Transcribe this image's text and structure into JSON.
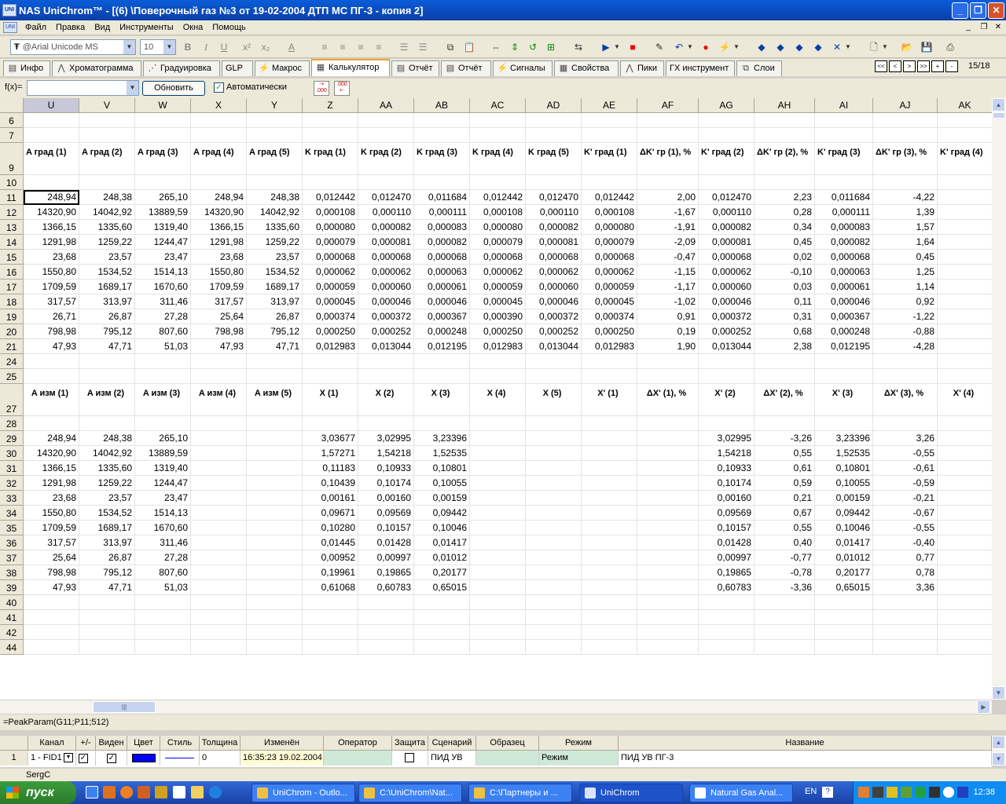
{
  "window": {
    "title": "NAS UniChrom™ - [(6) \\Поверочный газ  №3  от 19-02-2004 ДТП МС ПГ-3 - копия 2]",
    "icon": "UNI"
  },
  "menu": [
    "Файл",
    "Правка",
    "Вид",
    "Инструменты",
    "Окна",
    "Помощь"
  ],
  "toolbar": {
    "font": "@Arial Unicode MS",
    "size": "10",
    "page_counter": "15/18",
    "bold": "B",
    "italic": "I",
    "underline": "U",
    "superscript": "x²",
    "subscript": "x₂",
    "font_color": "A"
  },
  "tabs": [
    {
      "label": "Инфо",
      "icon": "info-icon"
    },
    {
      "label": "Хроматограмма",
      "icon": "chromatogram-icon"
    },
    {
      "label": "Градуировка",
      "icon": "calibration-icon"
    },
    {
      "label": "GLP",
      "icon": ""
    },
    {
      "label": "Макрос",
      "icon": "macro-icon"
    },
    {
      "label": "Калькулятор",
      "icon": "calculator-icon"
    },
    {
      "label": "Отчёт",
      "icon": "report-icon"
    },
    {
      "label": "Отчёт",
      "icon": "report-icon"
    },
    {
      "label": "Сигналы",
      "icon": "signals-icon"
    },
    {
      "label": "Свойства",
      "icon": "properties-icon"
    },
    {
      "label": "Пики",
      "icon": "peaks-icon"
    },
    {
      "label": "ГХ инструмент",
      "icon": ""
    },
    {
      "label": "Слои",
      "icon": "layers-icon"
    }
  ],
  "nav_buttons": [
    "<<",
    "<",
    ">",
    ">>",
    "+",
    "-"
  ],
  "formula_bar": {
    "label": "f(x)=",
    "value": "",
    "refresh_button": "Обновить",
    "auto_label": "Автоматически",
    "auto_checked": true
  },
  "columns": [
    "U",
    "V",
    "W",
    "X",
    "Y",
    "Z",
    "AA",
    "AB",
    "AC",
    "AD",
    "AE",
    "AF",
    "AG",
    "AH",
    "AI",
    "AJ",
    "AK"
  ],
  "rows": [
    {
      "n": "6",
      "cells": []
    },
    {
      "n": "7",
      "cells": []
    },
    {
      "n": "9",
      "type": "label",
      "cells": [
        "A град (1)",
        "A град (2)",
        "A град (3)",
        "A град (4)",
        "A град (5)",
        "K град (1)",
        "K град (2)",
        "K град (3)",
        "K град (4)",
        "K град (5)",
        "K' град (1)",
        "ΔK' гр (1), %",
        "K' град (2)",
        "ΔK' гр (2), %",
        "K' град (3)",
        "ΔK' гр (3), %",
        "K' град (4)"
      ]
    },
    {
      "n": "10",
      "cells": []
    },
    {
      "n": "11",
      "cells": [
        "248,94",
        "248,38",
        "265,10",
        "248,94",
        "248,38",
        "0,012442",
        "0,012470",
        "0,011684",
        "0,012442",
        "0,012470",
        "0,012442",
        "2,00",
        "0,012470",
        "2,23",
        "0,011684",
        "-4,22",
        ""
      ]
    },
    {
      "n": "12",
      "cells": [
        "14320,90",
        "14042,92",
        "13889,59",
        "14320,90",
        "14042,92",
        "0,000108",
        "0,000110",
        "0,000111",
        "0,000108",
        "0,000110",
        "0,000108",
        "-1,67",
        "0,000110",
        "0,28",
        "0,000111",
        "1,39",
        ""
      ]
    },
    {
      "n": "13",
      "cells": [
        "1366,15",
        "1335,60",
        "1319,40",
        "1366,15",
        "1335,60",
        "0,000080",
        "0,000082",
        "0,000083",
        "0,000080",
        "0,000082",
        "0,000080",
        "-1,91",
        "0,000082",
        "0,34",
        "0,000083",
        "1,57",
        ""
      ]
    },
    {
      "n": "14",
      "cells": [
        "1291,98",
        "1259,22",
        "1244,47",
        "1291,98",
        "1259,22",
        "0,000079",
        "0,000081",
        "0,000082",
        "0,000079",
        "0,000081",
        "0,000079",
        "-2,09",
        "0,000081",
        "0,45",
        "0,000082",
        "1,64",
        ""
      ]
    },
    {
      "n": "15",
      "cells": [
        "23,68",
        "23,57",
        "23,47",
        "23,68",
        "23,57",
        "0,000068",
        "0,000068",
        "0,000068",
        "0,000068",
        "0,000068",
        "0,000068",
        "-0,47",
        "0,000068",
        "0,02",
        "0,000068",
        "0,45",
        ""
      ]
    },
    {
      "n": "16",
      "cells": [
        "1550,80",
        "1534,52",
        "1514,13",
        "1550,80",
        "1534,52",
        "0,000062",
        "0,000062",
        "0,000063",
        "0,000062",
        "0,000062",
        "0,000062",
        "-1,15",
        "0,000062",
        "-0,10",
        "0,000063",
        "1,25",
        ""
      ]
    },
    {
      "n": "17",
      "cells": [
        "1709,59",
        "1689,17",
        "1670,60",
        "1709,59",
        "1689,17",
        "0,000059",
        "0,000060",
        "0,000061",
        "0,000059",
        "0,000060",
        "0,000059",
        "-1,17",
        "0,000060",
        "0,03",
        "0,000061",
        "1,14",
        ""
      ]
    },
    {
      "n": "18",
      "cells": [
        "317,57",
        "313,97",
        "311,46",
        "317,57",
        "313,97",
        "0,000045",
        "0,000046",
        "0,000046",
        "0,000045",
        "0,000046",
        "0,000045",
        "-1,02",
        "0,000046",
        "0,11",
        "0,000046",
        "0,92",
        ""
      ]
    },
    {
      "n": "19",
      "cells": [
        "26,71",
        "26,87",
        "27,28",
        "25,64",
        "26,87",
        "0,000374",
        "0,000372",
        "0,000367",
        "0,000390",
        "0,000372",
        "0,000374",
        "0,91",
        "0,000372",
        "0,31",
        "0,000367",
        "-1,22",
        ""
      ]
    },
    {
      "n": "20",
      "cells": [
        "798,98",
        "795,12",
        "807,60",
        "798,98",
        "795,12",
        "0,000250",
        "0,000252",
        "0,000248",
        "0,000250",
        "0,000252",
        "0,000250",
        "0,19",
        "0,000252",
        "0,68",
        "0,000248",
        "-0,88",
        ""
      ]
    },
    {
      "n": "21",
      "cells": [
        "47,93",
        "47,71",
        "51,03",
        "47,93",
        "47,71",
        "0,012983",
        "0,013044",
        "0,012195",
        "0,012983",
        "0,013044",
        "0,012983",
        "1,90",
        "0,013044",
        "2,38",
        "0,012195",
        "-4,28",
        ""
      ]
    },
    {
      "n": "24",
      "cells": []
    },
    {
      "n": "25",
      "cells": []
    },
    {
      "n": "27",
      "type": "label",
      "cells": [
        "A изм (1)",
        "A изм (2)",
        "A изм (3)",
        "A изм (4)",
        "A изм (5)",
        "X (1)",
        "X (2)",
        "X (3)",
        "X (4)",
        "X (5)",
        "X' (1)",
        "ΔX' (1), %",
        "X' (2)",
        "ΔX' (2), %",
        "X' (3)",
        "ΔX' (3), %",
        "X' (4)"
      ]
    },
    {
      "n": "28",
      "cells": []
    },
    {
      "n": "29",
      "cells": [
        "248,94",
        "248,38",
        "265,10",
        "",
        "",
        "3,03677",
        "3,02995",
        "3,23396",
        "",
        "",
        "",
        "",
        "3,02995",
        "-3,26",
        "3,23396",
        "3,26",
        ""
      ]
    },
    {
      "n": "30",
      "cells": [
        "14320,90",
        "14042,92",
        "13889,59",
        "",
        "",
        "1,57271",
        "1,54218",
        "1,52535",
        "",
        "",
        "",
        "",
        "1,54218",
        "0,55",
        "1,52535",
        "-0,55",
        ""
      ]
    },
    {
      "n": "31",
      "cells": [
        "1366,15",
        "1335,60",
        "1319,40",
        "",
        "",
        "0,11183",
        "0,10933",
        "0,10801",
        "",
        "",
        "",
        "",
        "0,10933",
        "0,61",
        "0,10801",
        "-0,61",
        ""
      ]
    },
    {
      "n": "32",
      "cells": [
        "1291,98",
        "1259,22",
        "1244,47",
        "",
        "",
        "0,10439",
        "0,10174",
        "0,10055",
        "",
        "",
        "",
        "",
        "0,10174",
        "0,59",
        "0,10055",
        "-0,59",
        ""
      ]
    },
    {
      "n": "33",
      "cells": [
        "23,68",
        "23,57",
        "23,47",
        "",
        "",
        "0,00161",
        "0,00160",
        "0,00159",
        "",
        "",
        "",
        "",
        "0,00160",
        "0,21",
        "0,00159",
        "-0,21",
        ""
      ]
    },
    {
      "n": "34",
      "cells": [
        "1550,80",
        "1534,52",
        "1514,13",
        "",
        "",
        "0,09671",
        "0,09569",
        "0,09442",
        "",
        "",
        "",
        "",
        "0,09569",
        "0,67",
        "0,09442",
        "-0,67",
        ""
      ]
    },
    {
      "n": "35",
      "cells": [
        "1709,59",
        "1689,17",
        "1670,60",
        "",
        "",
        "0,10280",
        "0,10157",
        "0,10046",
        "",
        "",
        "",
        "",
        "0,10157",
        "0,55",
        "0,10046",
        "-0,55",
        ""
      ]
    },
    {
      "n": "36",
      "cells": [
        "317,57",
        "313,97",
        "311,46",
        "",
        "",
        "0,01445",
        "0,01428",
        "0,01417",
        "",
        "",
        "",
        "",
        "0,01428",
        "0,40",
        "0,01417",
        "-0,40",
        ""
      ]
    },
    {
      "n": "37",
      "cells": [
        "25,64",
        "26,87",
        "27,28",
        "",
        "",
        "0,00952",
        "0,00997",
        "0,01012",
        "",
        "",
        "",
        "",
        "0,00997",
        "-0,77",
        "0,01012",
        "0,77",
        ""
      ]
    },
    {
      "n": "38",
      "cells": [
        "798,98",
        "795,12",
        "807,60",
        "",
        "",
        "0,19961",
        "0,19865",
        "0,20177",
        "",
        "",
        "",
        "",
        "0,19865",
        "-0,78",
        "0,20177",
        "0,78",
        ""
      ]
    },
    {
      "n": "39",
      "cells": [
        "47,93",
        "47,71",
        "51,03",
        "",
        "",
        "0,61068",
        "0,60783",
        "0,65015",
        "",
        "",
        "",
        "",
        "0,60783",
        "-3,36",
        "0,65015",
        "3,36",
        ""
      ]
    },
    {
      "n": "40",
      "cells": []
    },
    {
      "n": "41",
      "cells": []
    },
    {
      "n": "42",
      "cells": []
    },
    {
      "n": "44",
      "cells": []
    }
  ],
  "status_formula": "=PeakParam(G11;P11;512)",
  "channels": {
    "headers": [
      "Канал",
      "+/-",
      "Виден",
      "Цвет",
      "Стиль",
      "Толщина",
      "Изменён",
      "Оператор",
      "Защита",
      "Сценарий",
      "Образец",
      "Режим",
      "Название"
    ],
    "row": {
      "num": "1",
      "channel": "1 - FID1",
      "plus_minus": true,
      "visible": true,
      "color": "#0000ff",
      "thickness": "0",
      "changed": "16:35:23 19.02.2004",
      "operator": "",
      "protect": false,
      "scenario": "ПИД  УВ",
      "sample": "",
      "mode": "Режим",
      "name": "ПИД УВ ПГ-3"
    }
  },
  "footer_user": "SergC",
  "taskbar": {
    "start": "пуск",
    "tasks": [
      "UniChrom - Outlo...",
      "C:\\UniChrom\\Nat...",
      "C:\\Партнеры и ...",
      "UniChrom",
      "Natural Gas Anal..."
    ],
    "active": 3,
    "lang": "EN",
    "clock": "12:38"
  }
}
